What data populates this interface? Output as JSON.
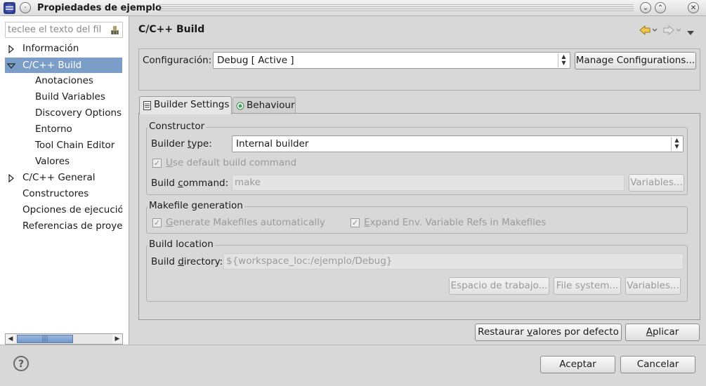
{
  "window": {
    "title": "Propiedades de ejemplo"
  },
  "left": {
    "filter_placeholder": "teclee el texto del fil",
    "tree": [
      {
        "label": "Información",
        "expanded": false
      },
      {
        "label": "C/C++ Build",
        "expanded": true,
        "selected": true
      },
      {
        "label": "Anotaciones"
      },
      {
        "label": "Build Variables"
      },
      {
        "label": "Discovery Options"
      },
      {
        "label": "Entorno"
      },
      {
        "label": "Tool Chain Editor"
      },
      {
        "label": "Valores"
      },
      {
        "label": "C/C++ General",
        "expanded": false
      },
      {
        "label": "Constructores"
      },
      {
        "label": "Opciones de ejecució"
      },
      {
        "label": "Referencias de proye"
      }
    ],
    "scroll_thumb": "|||"
  },
  "header": {
    "title": "C/C++ Build"
  },
  "config": {
    "label": "Configuración:",
    "value": "Debug  [ Active ]",
    "manage_button": "Manage Configurations..."
  },
  "tabs": [
    {
      "label": "Builder Settings",
      "active": true
    },
    {
      "label": "Behaviour",
      "active": false
    }
  ],
  "constructor_group": {
    "title": "Constructor",
    "builder_type_label_pre": "Builder ",
    "builder_type_label_u": "t",
    "builder_type_label_post": "ype:",
    "builder_type_value": "Internal builder",
    "use_default_u": "U",
    "use_default_rest": "se default build command",
    "use_default_checked": true,
    "build_command_label_pre": "Build ",
    "build_command_label_u": "c",
    "build_command_label_post": "ommand:",
    "build_command_value": "make",
    "variables_button": "Variables..."
  },
  "makefile_group": {
    "title": "Makefile generation",
    "generate_u": "G",
    "generate_rest": "enerate Makefiles automatically",
    "generate_checked": true,
    "expand_u": "E",
    "expand_rest": "xpand Env. Variable Refs in Makefiles",
    "expand_checked": true
  },
  "location_group": {
    "title": "Build location",
    "dir_label_pre": "Build ",
    "dir_label_u": "d",
    "dir_label_post": "irectory:",
    "dir_value": "${workspace_loc:/ejemplo/Debug}",
    "workspace_button": "Espacio de trabajo...",
    "filesystem_button": "File system...",
    "variables_button": "Variables..."
  },
  "actions": {
    "restore_pre": "Restaurar ",
    "restore_u": "v",
    "restore_post": "alores por defecto",
    "apply_u": "A",
    "apply_post": "plicar"
  },
  "dialog": {
    "ok": "Aceptar",
    "cancel": "Cancelar",
    "help": "?"
  },
  "colors": {
    "selection": "#7b9ec9",
    "background": "#d8d8d8"
  }
}
